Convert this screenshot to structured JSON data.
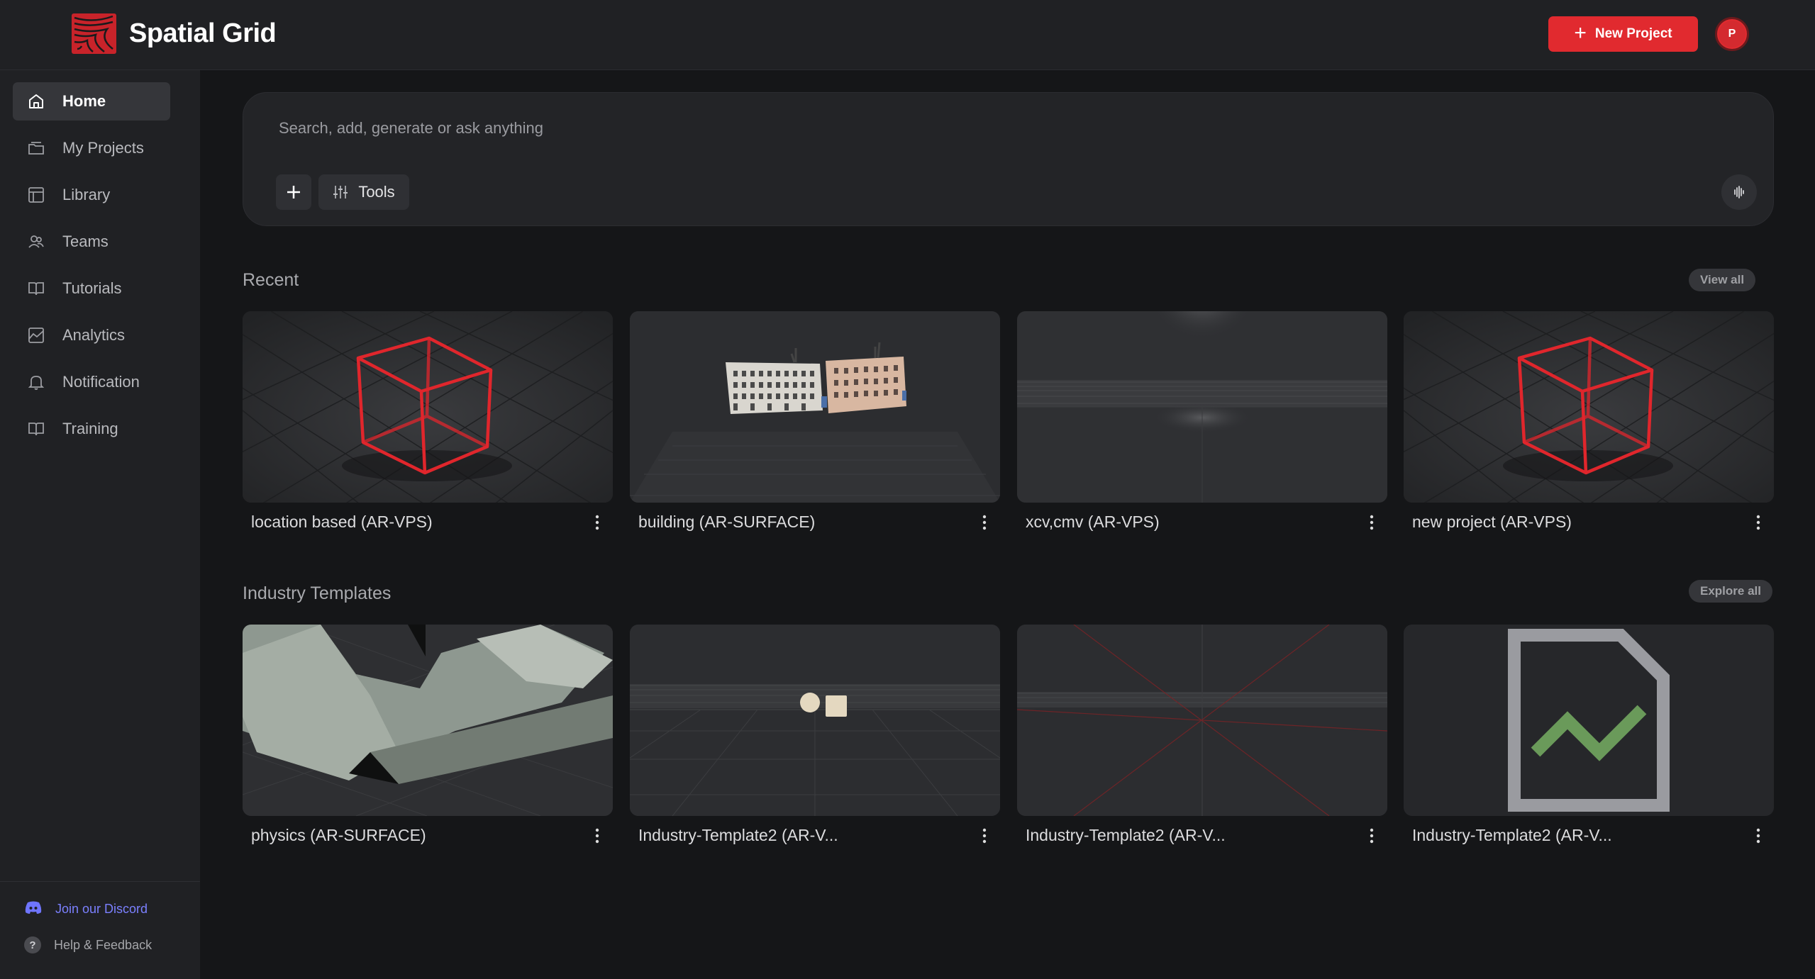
{
  "app": {
    "name": "Spatial Grid",
    "new_project_label": "New Project",
    "avatar_initial": "P",
    "accent": "#e12a2f"
  },
  "sidebar": {
    "items": [
      {
        "label": "Home",
        "icon": "home-icon",
        "active": true
      },
      {
        "label": "My Projects",
        "icon": "folder-icon",
        "active": false
      },
      {
        "label": "Library",
        "icon": "library-icon",
        "active": false
      },
      {
        "label": "Teams",
        "icon": "teams-icon",
        "active": false
      },
      {
        "label": "Tutorials",
        "icon": "book-icon",
        "active": false
      },
      {
        "label": "Analytics",
        "icon": "analytics-icon",
        "active": false
      },
      {
        "label": "Notification",
        "icon": "bell-icon",
        "active": false
      },
      {
        "label": "Training",
        "icon": "book-icon",
        "active": false
      }
    ],
    "discord_label": "Join our Discord",
    "help_label": "Help & Feedback"
  },
  "search": {
    "placeholder": "Search, add, generate or ask anything",
    "value": "",
    "tools_label": "Tools"
  },
  "recent": {
    "title": "Recent",
    "view_all_label": "View all",
    "cards": [
      {
        "label": "location based (AR-VPS)",
        "thumb": "red-cube"
      },
      {
        "label": "building (AR-SURFACE)",
        "thumb": "buildings"
      },
      {
        "label": "xcv,cmv (AR-VPS)",
        "thumb": "empty-grid"
      },
      {
        "label": "new project (AR-VPS)",
        "thumb": "red-cube"
      }
    ]
  },
  "templates": {
    "title": "Industry Templates",
    "explore_all_label": "Explore all",
    "cards": [
      {
        "label": "physics (AR-SURFACE)",
        "thumb": "terrain"
      },
      {
        "label": "Industry-Template2 (AR-V...",
        "thumb": "shapes"
      },
      {
        "label": "Industry-Template2 (AR-V...",
        "thumb": "red-lines"
      },
      {
        "label": "Industry-Template2 (AR-V...",
        "thumb": "broken",
        "alt": "thumbnail"
      }
    ]
  }
}
